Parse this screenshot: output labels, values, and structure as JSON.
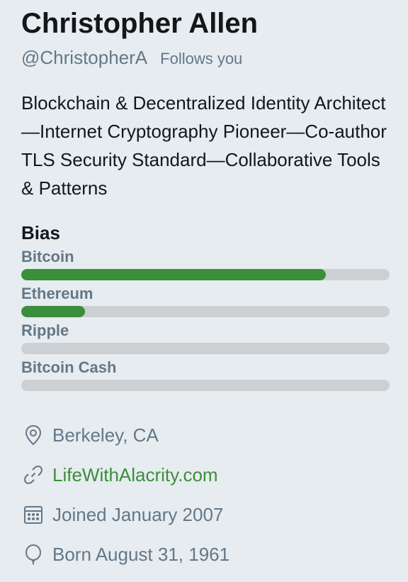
{
  "profile": {
    "name": "Christopher Allen",
    "handle": "@ChristopherA",
    "follows_you": "Follows you",
    "bio": "Blockchain & Decentralized Identity Architect—Internet Cryptography Pioneer—Co-author TLS Security Standard—Collaborative Tools & Patterns"
  },
  "bias": {
    "title": "Bias",
    "items": [
      {
        "label": "Bitcoin",
        "fraction": 0.827
      },
      {
        "label": "Ethereum",
        "fraction": 0.173
      },
      {
        "label": "Ripple",
        "fraction": 0
      },
      {
        "label": "Bitcoin Cash",
        "fraction": 0
      }
    ],
    "fill_color": "#3b8e3b",
    "track_color": "#ccd0d3"
  },
  "meta": {
    "location": "Berkeley, CA",
    "website": "LifeWithAlacrity.com",
    "joined": "Joined January 2007",
    "born": "Born August 31, 1961"
  },
  "icons": {
    "location": "location-pin-icon",
    "website": "link-icon",
    "joined": "calendar-icon",
    "born": "balloon-icon"
  }
}
